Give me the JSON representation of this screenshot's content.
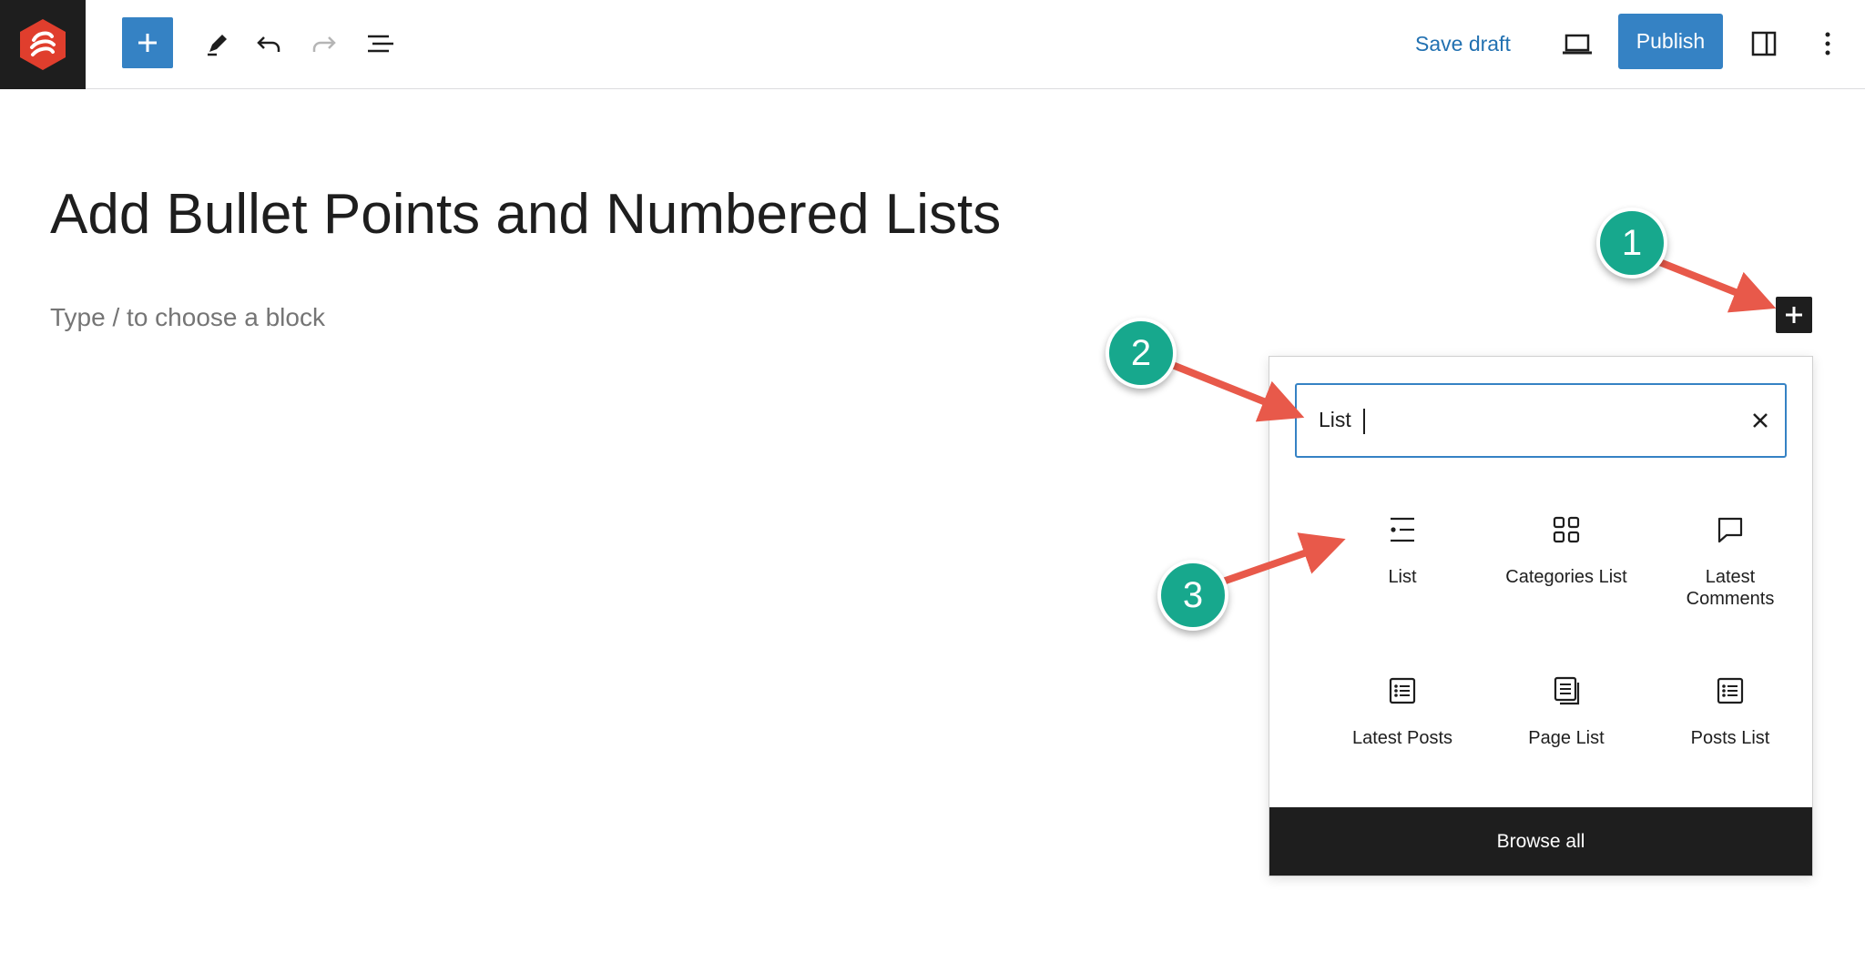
{
  "toolbar": {
    "add_block_icon": "plus-icon",
    "tools_icon": "pencil-icon",
    "undo_icon": "undo-icon",
    "redo_icon": "redo-icon",
    "outline_icon": "list-view-icon",
    "save_draft_label": "Save draft",
    "preview_icon": "laptop-icon",
    "publish_label": "Publish",
    "settings_icon": "sidebar-toggle-icon",
    "options_icon": "more-vertical-icon"
  },
  "editor": {
    "title": "Add Bullet Points and Numbered Lists",
    "block_placeholder": "Type / to choose a block"
  },
  "inserter": {
    "search_value": "List",
    "blocks": [
      {
        "label": "List",
        "icon": "list-icon"
      },
      {
        "label": "Categories List",
        "icon": "categories-icon"
      },
      {
        "label": "Latest Comments",
        "icon": "comment-icon"
      },
      {
        "label": "Latest Posts",
        "icon": "post-list-icon"
      },
      {
        "label": "Page List",
        "icon": "pages-icon"
      },
      {
        "label": "Posts List",
        "icon": "post-list-icon"
      }
    ],
    "browse_all_label": "Browse all"
  },
  "callouts": [
    "1",
    "2",
    "3"
  ],
  "colors": {
    "accent": "#3582c4",
    "callout": "#17a88d",
    "arrow": "#e8594a",
    "dark": "#1e1e1e"
  }
}
